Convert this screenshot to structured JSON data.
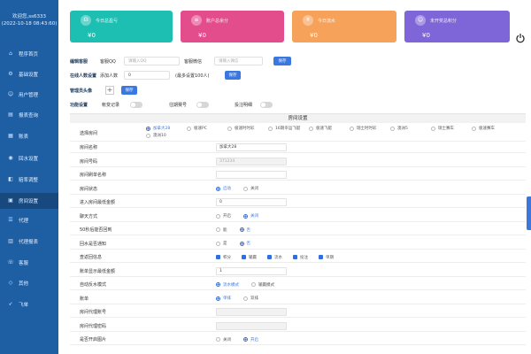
{
  "sidebar": {
    "welcome": "欢迎您,ss6333",
    "datetime": "(2022-10-18 08:43:60)",
    "items": [
      {
        "label": "程序首页",
        "icon": "home-icon"
      },
      {
        "label": "基础设置",
        "icon": "settings-icon"
      },
      {
        "label": "用户管理",
        "icon": "user-icon"
      },
      {
        "label": "报表查询",
        "icon": "chart-icon"
      },
      {
        "label": "账表",
        "icon": "ledger-icon"
      },
      {
        "label": "回水设置",
        "icon": "water-icon"
      },
      {
        "label": "赔率调整",
        "icon": "odds-icon"
      },
      {
        "label": "房间设置",
        "icon": "room-icon"
      },
      {
        "label": "代理",
        "icon": "agent-icon"
      },
      {
        "label": "代理报表",
        "icon": "report-icon"
      },
      {
        "label": "客服",
        "icon": "service-icon"
      },
      {
        "label": "其他",
        "icon": "other-icon"
      },
      {
        "label": "飞单",
        "icon": "fly-icon"
      }
    ],
    "active_index": 7
  },
  "cards": [
    {
      "title": "今日总盈亏",
      "value": "¥0",
      "color": "#1dbfb3",
      "icon": "headset-icon"
    },
    {
      "title": "账户总余分",
      "value": "¥0",
      "color": "#e34d8c",
      "icon": "database-icon"
    },
    {
      "title": "今日流水",
      "value": "¥0",
      "color": "#f7a25b",
      "icon": "coin-icon"
    },
    {
      "title": "未开奖总积分",
      "value": "¥0",
      "color": "#7f66d8",
      "icon": "person-icon"
    }
  ],
  "top_settings": {
    "service_label": "编辑客服",
    "qq_label": "客服QQ",
    "qq_placeholder": "请输入QQ",
    "wechat_label": "客服微信",
    "wechat_placeholder": "请输入微信",
    "save_label": "保存",
    "online_label": "在线人数设置",
    "add_people_label": "添加人数",
    "add_people_value": "0",
    "max_hint": "(最多设置100人)",
    "online_save": "保存",
    "admin_avatar_label": "管理员头像",
    "avatar_save": "保存",
    "function_label": "功能设置",
    "account_record": "帐变记录",
    "past_periods": "往期赛号",
    "bet_notice": "投注明细"
  },
  "room": {
    "header": "房间设置",
    "choose_room_label": "选择房间",
    "rooms_row1": [
      "加拿大28",
      "极速PC",
      "极速时时彩",
      "16期幸运飞艇",
      "极速飞艇",
      "瑞士时时彩",
      "澳洲5",
      "瑞士赛车",
      "极速赛车"
    ],
    "rooms_row2": [
      "澳洲10"
    ],
    "selected_room": "加拿大28",
    "rows": [
      {
        "label": "房间名称",
        "value": "加拿大28"
      },
      {
        "label": "房间号码",
        "value": "371234"
      },
      {
        "label": "房间刷单名称",
        "value": ""
      },
      {
        "label": "房间状态",
        "opts": [
          "启动",
          "关闭"
        ],
        "on": 0
      },
      {
        "label": "进入房间最低金额",
        "value": "0"
      },
      {
        "label": "聊天方式",
        "opts": [
          "开启",
          "关闭"
        ],
        "on": 1
      },
      {
        "label": "50秒后能否回到",
        "opts": [
          "能",
          "否"
        ],
        "on": 1
      },
      {
        "label": "回水是否通知",
        "opts": [
          "是",
          "否"
        ],
        "on": 1
      },
      {
        "label": "查返回信息",
        "checks": [
          "积分",
          "输赢",
          "流水",
          "投注",
          "单期"
        ]
      },
      {
        "label": "账单显示最低金额",
        "value": "1"
      },
      {
        "label": "自动反水模式",
        "opts": [
          "流水模式",
          "输赢模式"
        ],
        "on": 0
      },
      {
        "label": "账单",
        "opts": [
          "单排",
          "双排"
        ],
        "on": 0
      },
      {
        "label": "房间代理账号",
        "value": ""
      },
      {
        "label": "房间代理密码",
        "value": ""
      },
      {
        "label": "是否开启图片",
        "opts": [
          "关闭",
          "开启"
        ],
        "on": 1
      }
    ]
  }
}
